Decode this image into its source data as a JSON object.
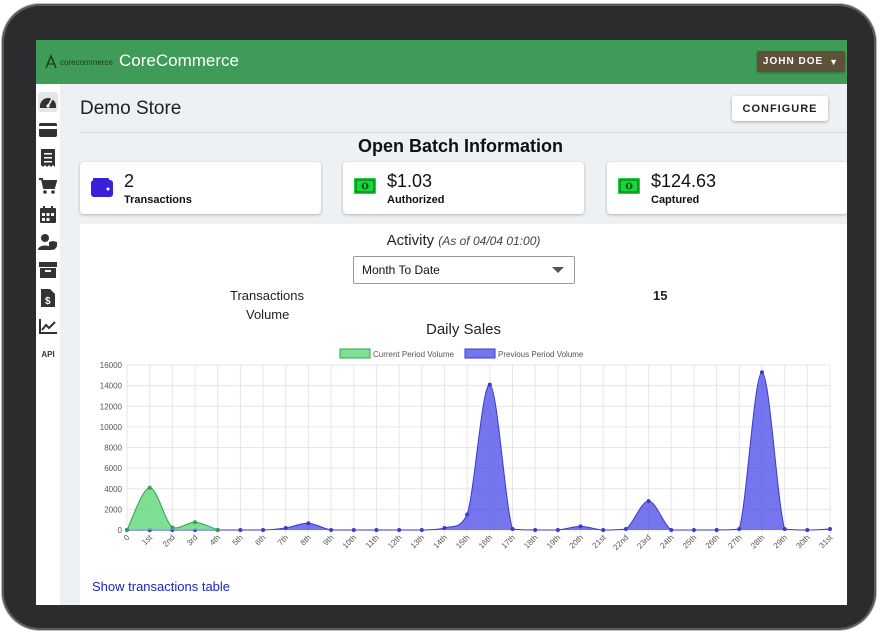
{
  "header": {
    "logo_text": "corecommerce",
    "brand": "CoreCommerce",
    "user_label": "JOHN DOE",
    "user_caret": "▼"
  },
  "sidebar": {
    "items": [
      {
        "icon": "dashboard-icon"
      },
      {
        "icon": "credit-card-icon"
      },
      {
        "icon": "receipt-icon"
      },
      {
        "icon": "cart-icon"
      },
      {
        "icon": "calendar-icon"
      },
      {
        "icon": "user-shield-icon"
      },
      {
        "icon": "box-icon"
      },
      {
        "icon": "invoice-dollar-icon"
      },
      {
        "icon": "chart-line-icon"
      },
      {
        "icon": "api-icon",
        "label": "API"
      }
    ]
  },
  "main": {
    "store_name": "Demo Store",
    "configure_label": "CONFIGURE",
    "batch_title": "Open Batch Information",
    "cards": [
      {
        "icon": "wallet-icon",
        "value": "2",
        "label": "Transactions"
      },
      {
        "icon": "money-icon",
        "value": "$1.03",
        "label": "Authorized"
      },
      {
        "icon": "money-icon",
        "value": "$124.63",
        "label": "Captured"
      }
    ],
    "activity": {
      "title": "Activity",
      "as_of": "(As of 04/04 01:00)",
      "period": "Month To Date",
      "transactions_label": "Transactions",
      "transactions_value": "15",
      "volume_label": "Volume"
    },
    "show_table_link": "Show transactions table"
  },
  "colors": {
    "header_green": "#3f9b58",
    "current_fill": "#5fd87a",
    "previous_fill": "#5353e8",
    "link": "#1a25c9"
  },
  "chart_data": {
    "type": "area",
    "title": "Daily Sales",
    "x": [
      "0",
      "1st",
      "2nd",
      "3rd",
      "4th",
      "5th",
      "6th",
      "7th",
      "8th",
      "9th",
      "10th",
      "11th",
      "12th",
      "13th",
      "14th",
      "15th",
      "16th",
      "17th",
      "18th",
      "19th",
      "20th",
      "21st",
      "22nd",
      "23rd",
      "24th",
      "25th",
      "26th",
      "27th",
      "28th",
      "29th",
      "30th",
      "31st"
    ],
    "ylim": [
      0,
      16000
    ],
    "yticks": [
      0,
      2000,
      4000,
      6000,
      8000,
      10000,
      12000,
      14000,
      16000
    ],
    "grid": true,
    "legend": "top",
    "series": [
      {
        "name": "Current Period Volume",
        "values": [
          0,
          4100,
          250,
          750,
          0
        ]
      },
      {
        "name": "Previous Period Volume",
        "values": [
          0,
          0,
          0,
          0,
          0,
          0,
          0,
          200,
          650,
          0,
          0,
          0,
          0,
          0,
          200,
          1500,
          14100,
          100,
          0,
          0,
          350,
          0,
          100,
          2800,
          0,
          0,
          0,
          100,
          15300,
          100,
          0,
          100
        ]
      }
    ]
  }
}
